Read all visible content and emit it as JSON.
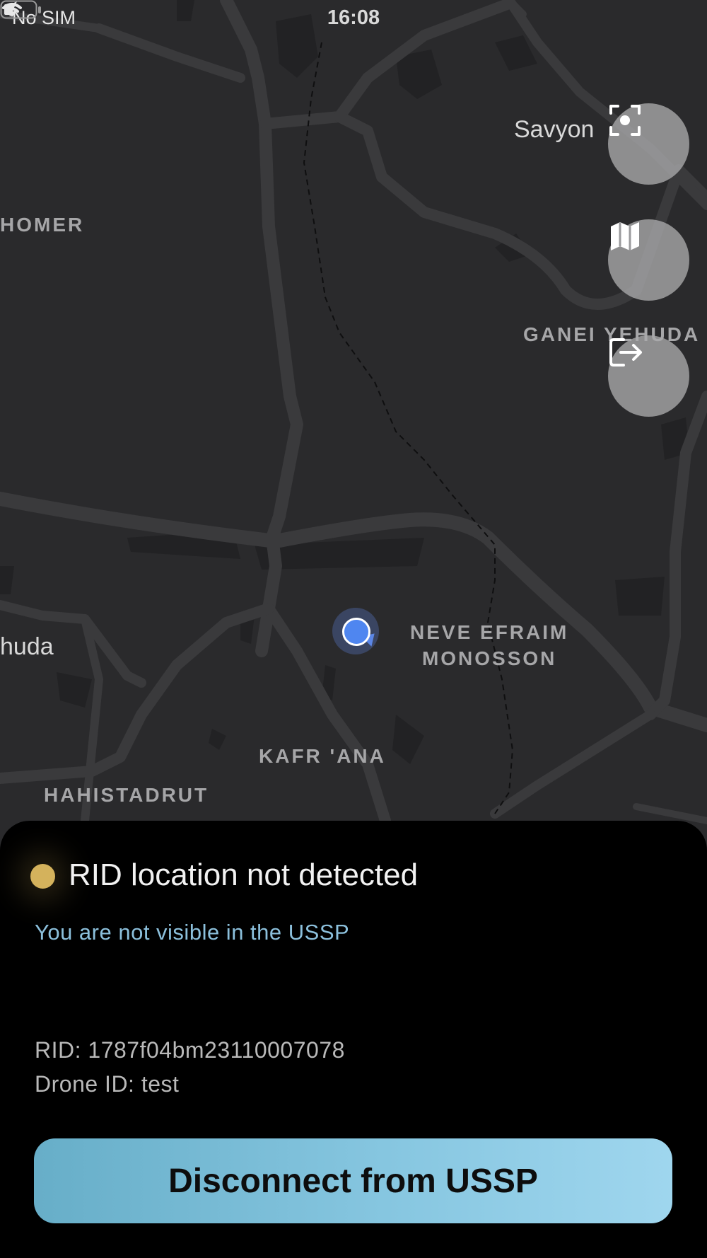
{
  "status_bar": {
    "carrier": "No SIM",
    "time": "16:08"
  },
  "map": {
    "labels": {
      "homer": "HOMER",
      "ganei_yehuda": "GANEI YEHUDA",
      "neve_efraim": "NEVE EFRAIM\nMONOSSON",
      "kafr_ana": "KAFR 'ANA",
      "hahistadrut": "HAHISTADRUT"
    },
    "places": {
      "savyon": "Savyon",
      "yehuda_partial": "huda"
    }
  },
  "controls": {
    "recenter_icon": "focus-frame-icon",
    "map_type_icon": "map-icon",
    "logout_icon": "logout-arrow-icon"
  },
  "panel": {
    "status_title": "RID location not detected",
    "status_subtitle": "You are not visible in the USSP",
    "rid": "RID: 1787f04bm23110007078",
    "drone_id": "Drone ID: test",
    "disconnect_label": "Disconnect from USSP"
  },
  "colors": {
    "status_dot": "#d4b25c",
    "subtitle": "#8cc0dc",
    "button_start": "#67aec8",
    "button_end": "#9fd6ee",
    "user_location": "#4f86f0"
  }
}
